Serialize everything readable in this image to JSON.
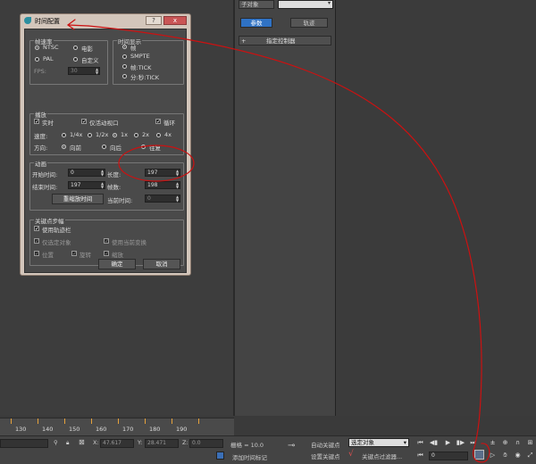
{
  "dialog": {
    "title": "时间配置",
    "frame_rate": {
      "title": "帧速率",
      "ntsc": "NTSC",
      "film": "电影",
      "pal": "PAL",
      "custom": "自定义",
      "fps_label": "FPS:",
      "fps_value": "30"
    },
    "time_display": {
      "title": "时间显示",
      "frames": "帧",
      "smpte": "SMPTE",
      "frame_tick": "帧:TICK",
      "mm_ss_tick": "分:秒:TICK"
    },
    "playback": {
      "title": "播放",
      "real_time": "实时",
      "active_viewport_only": "仅活动视口",
      "loop": "循环",
      "speed_label": "速度:",
      "speeds": [
        "1/4x",
        "1/2x",
        "1x",
        "2x",
        "4x"
      ],
      "direction_label": "方向:",
      "directions": [
        "向前",
        "向后",
        "往复"
      ]
    },
    "animation": {
      "title": "动画",
      "start_label": "开始时间:",
      "start_value": "0",
      "length_label": "长度:",
      "length_value": "197",
      "end_label": "结束时间:",
      "end_value": "197",
      "frame_count_label": "帧数:",
      "frame_count_value": "198",
      "rescale_label": "重缩放时间",
      "current_label": "当前时间:",
      "current_value": "0"
    },
    "key_steps": {
      "title": "关键点步幅",
      "use_trackbar": "使用轨迹栏",
      "selected_only": "仅选定对象",
      "use_current_transform": "使用当前变换",
      "position": "位置",
      "rotation": "旋转",
      "scale": "缩放"
    },
    "ok": "确定",
    "cancel": "取消",
    "help_icon": "?",
    "close_icon": "x"
  },
  "command_panel": {
    "object_type": "子对象",
    "tab_params": "参数",
    "tab_track": "轨迹",
    "assign_controller": "指定控制器"
  },
  "timeline": {
    "ticks": [
      "130",
      "140",
      "150",
      "160",
      "170",
      "180",
      "190"
    ]
  },
  "status": {
    "x_label": "X:",
    "x_value": "47.617",
    "y_label": "Y:",
    "y_value": "28.471",
    "z_label": "Z:",
    "z_value": "0.0",
    "grid": "栅格 = 10.0",
    "add_time_tag": "添加时间标记",
    "auto_key": "自动关键点",
    "selected_object": "选定对象",
    "set_key": "设置关键点",
    "key_filters": "关键点过滤器...",
    "frame_value": "0"
  },
  "colors": {
    "annotation": "#cc1111",
    "dialog_frame": "#d3c6bb",
    "tab_active": "#2f72c4",
    "timeline_tick": "#e6a23c"
  },
  "icons": [
    "max-logo-icon",
    "help-icon",
    "close-icon",
    "key-icon",
    "lock-icon",
    "time-config-icon",
    "play-icon",
    "pan-icon",
    "orbit-icon",
    "zoom-icon"
  ]
}
